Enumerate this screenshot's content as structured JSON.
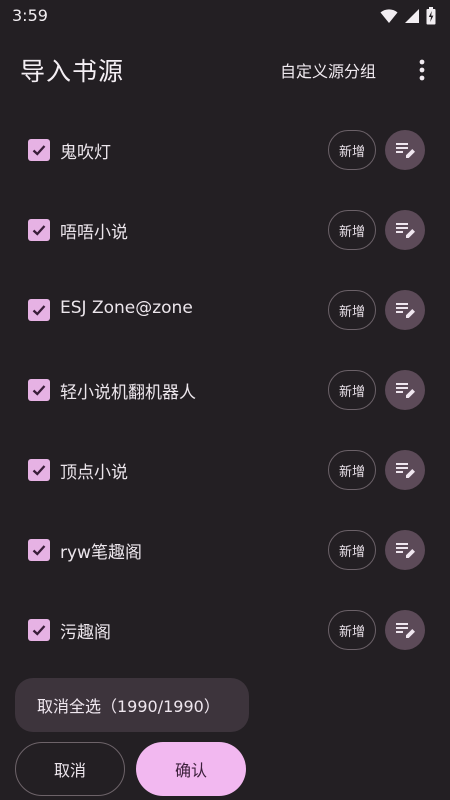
{
  "status_bar": {
    "time": "3:59"
  },
  "app_bar": {
    "title": "导入书源",
    "group_button_label": "自定义源分组"
  },
  "sources": [
    {
      "name": "鬼吹灯",
      "checked": true,
      "add_label": "新增"
    },
    {
      "name": "唔唔小说",
      "checked": true,
      "add_label": "新增"
    },
    {
      "name": "ESJ Zone@zone",
      "checked": true,
      "add_label": "新增"
    },
    {
      "name": "轻小说机翻机器人",
      "checked": true,
      "add_label": "新增"
    },
    {
      "name": "顶点小说",
      "checked": true,
      "add_label": "新增"
    },
    {
      "name": "ryw笔趣阁",
      "checked": true,
      "add_label": "新增"
    },
    {
      "name": "污趣阁",
      "checked": true,
      "add_label": "新增"
    }
  ],
  "footer": {
    "select_all_label": "取消全选（1990/1990）",
    "cancel_label": "取消",
    "confirm_label": "确认"
  },
  "colors": {
    "background": "#231f23",
    "checkbox": "#e6b2e4",
    "confirm": "#f2b8f0",
    "edit_button": "#5c4a58"
  },
  "icons": {
    "checkbox": "check-icon",
    "edit": "edit-list-icon",
    "more": "more-vert-icon"
  }
}
